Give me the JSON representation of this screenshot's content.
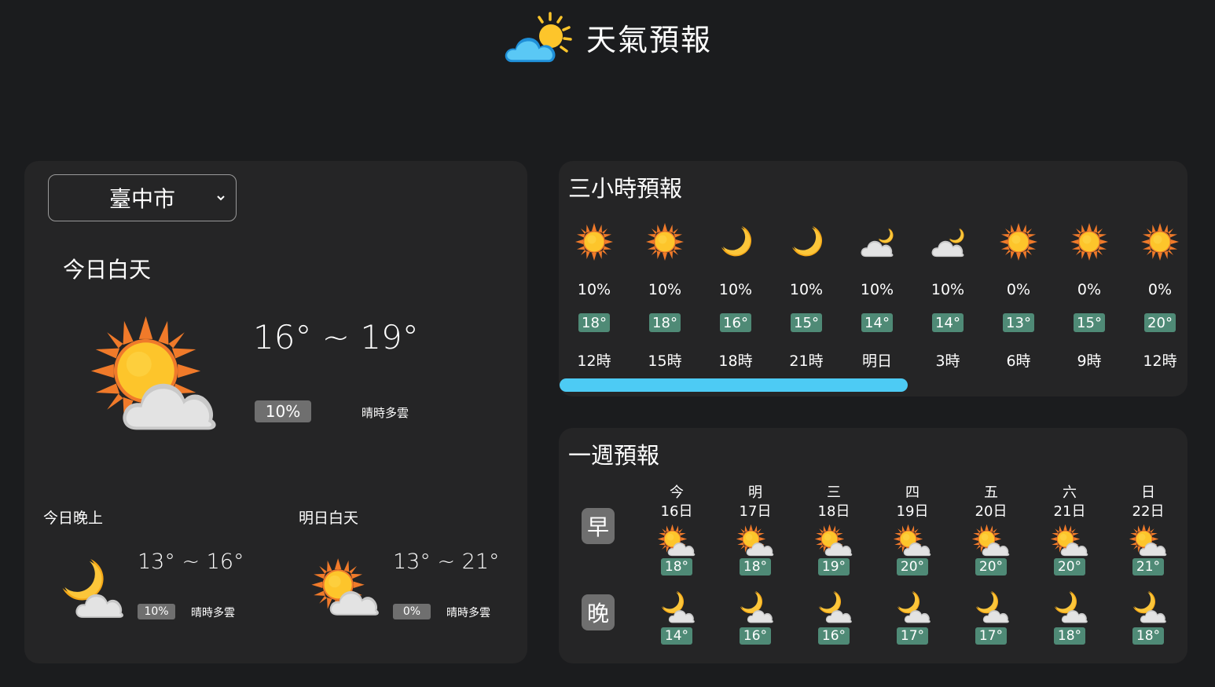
{
  "header": {
    "title": "天氣預報",
    "logo_icon": "sun-behind-cloud-icon"
  },
  "today": {
    "city_selected": "臺中市",
    "label": "今日白天",
    "icon": "sun-behind-cloud-icon",
    "temp_range": "16° ~ 19°",
    "pop": "10%",
    "description": "晴時多雲",
    "tonight": {
      "label": "今日晚上",
      "icon": "moon-behind-cloud-icon",
      "temp_range": "13° ~ 16°",
      "pop": "10%",
      "description": "晴時多雲"
    },
    "tomorrow": {
      "label": "明日白天",
      "icon": "sun-behind-cloud-icon",
      "temp_range": "13° ~ 21°",
      "pop": "0%",
      "description": "晴時多雲"
    }
  },
  "hourly": {
    "title": "三小時預報",
    "items": [
      {
        "icon": "sun",
        "pop": "10%",
        "temp": "18°",
        "time": "12時"
      },
      {
        "icon": "sun",
        "pop": "10%",
        "temp": "18°",
        "time": "15時"
      },
      {
        "icon": "moon",
        "pop": "10%",
        "temp": "16°",
        "time": "18時"
      },
      {
        "icon": "moon",
        "pop": "10%",
        "temp": "15°",
        "time": "21時"
      },
      {
        "icon": "moon-cloud",
        "pop": "10%",
        "temp": "14°",
        "time": "明日"
      },
      {
        "icon": "moon-cloud",
        "pop": "10%",
        "temp": "14°",
        "time": "3時"
      },
      {
        "icon": "sun",
        "pop": "0%",
        "temp": "13°",
        "time": "6時"
      },
      {
        "icon": "sun",
        "pop": "0%",
        "temp": "15°",
        "time": "9時"
      },
      {
        "icon": "sun",
        "pop": "0%",
        "temp": "20°",
        "time": "12時"
      }
    ],
    "scroll_fraction": 0.55
  },
  "weekly": {
    "title": "一週預報",
    "day_label": "早",
    "night_label": "晚",
    "days": [
      {
        "name": "今",
        "date": "16日",
        "day_icon": "sun-behind-cloud",
        "day_temp": "18°",
        "night_icon": "moon-behind-cloud",
        "night_temp": "14°"
      },
      {
        "name": "明",
        "date": "17日",
        "day_icon": "sun-behind-cloud",
        "day_temp": "18°",
        "night_icon": "moon-behind-cloud",
        "night_temp": "16°"
      },
      {
        "name": "三",
        "date": "18日",
        "day_icon": "sun-behind-cloud",
        "day_temp": "19°",
        "night_icon": "moon-behind-cloud",
        "night_temp": "16°"
      },
      {
        "name": "四",
        "date": "19日",
        "day_icon": "sun-behind-cloud",
        "day_temp": "20°",
        "night_icon": "moon-behind-cloud",
        "night_temp": "17°"
      },
      {
        "name": "五",
        "date": "20日",
        "day_icon": "sun-behind-cloud",
        "day_temp": "20°",
        "night_icon": "moon-behind-cloud",
        "night_temp": "17°"
      },
      {
        "name": "六",
        "date": "21日",
        "day_icon": "sun-behind-cloud",
        "day_temp": "20°",
        "night_icon": "moon-behind-cloud",
        "night_temp": "18°"
      },
      {
        "name": "日",
        "date": "22日",
        "day_icon": "sun-behind-cloud",
        "day_temp": "21°",
        "night_icon": "moon-behind-cloud",
        "night_temp": "18°"
      }
    ]
  },
  "colors": {
    "background": "#1b1c1e",
    "card": "#252526",
    "temp_tag": "#4f8a76",
    "pop_badge": "#6f6f6f",
    "scrollbar": "#4dcbf4",
    "sun": "#fdc52b",
    "sun_rays": "#f07a2a",
    "moon": "#f5b21c",
    "cloud": "#d9d9d9"
  }
}
